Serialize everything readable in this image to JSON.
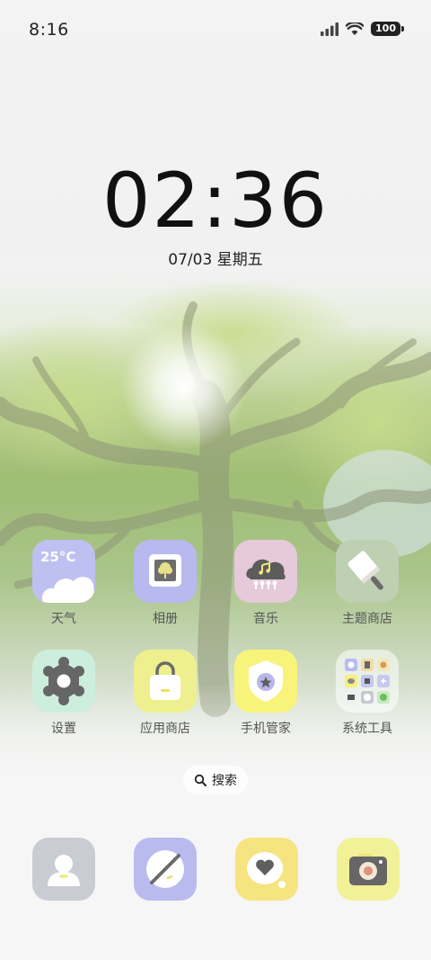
{
  "status_bar": {
    "time": "8:16",
    "battery": "100"
  },
  "lock_clock": {
    "time": "02:36",
    "date": "07/03 星期五"
  },
  "apps_row1": [
    {
      "label": "天气",
      "icon": "weather-icon",
      "badge": "25°C"
    },
    {
      "label": "相册",
      "icon": "gallery-icon"
    },
    {
      "label": "音乐",
      "icon": "music-icon"
    },
    {
      "label": "主题商店",
      "icon": "theme-store-icon"
    }
  ],
  "apps_row2": [
    {
      "label": "设置",
      "icon": "settings-icon"
    },
    {
      "label": "应用商店",
      "icon": "app-store-icon"
    },
    {
      "label": "手机管家",
      "icon": "phone-manager-icon"
    },
    {
      "label": "系统工具",
      "icon": "system-tools-folder-icon"
    }
  ],
  "search": {
    "label": "搜索"
  },
  "dock": [
    {
      "icon": "contacts-icon"
    },
    {
      "icon": "browser-icon"
    },
    {
      "icon": "messages-icon"
    },
    {
      "icon": "camera-icon"
    }
  ],
  "colors": {
    "weather": "#bfc0f2",
    "gallery": "#b7b9ef",
    "music": "#e6c9da",
    "theme_store": "#bdd0b2",
    "settings": "#cdeedd",
    "app_store": "#eef08f",
    "phone_manager": "#f8f37a",
    "contacts": "#c9ccd2",
    "browser": "#b9bbef",
    "messages": "#f6e480",
    "camera": "#f1f197"
  }
}
